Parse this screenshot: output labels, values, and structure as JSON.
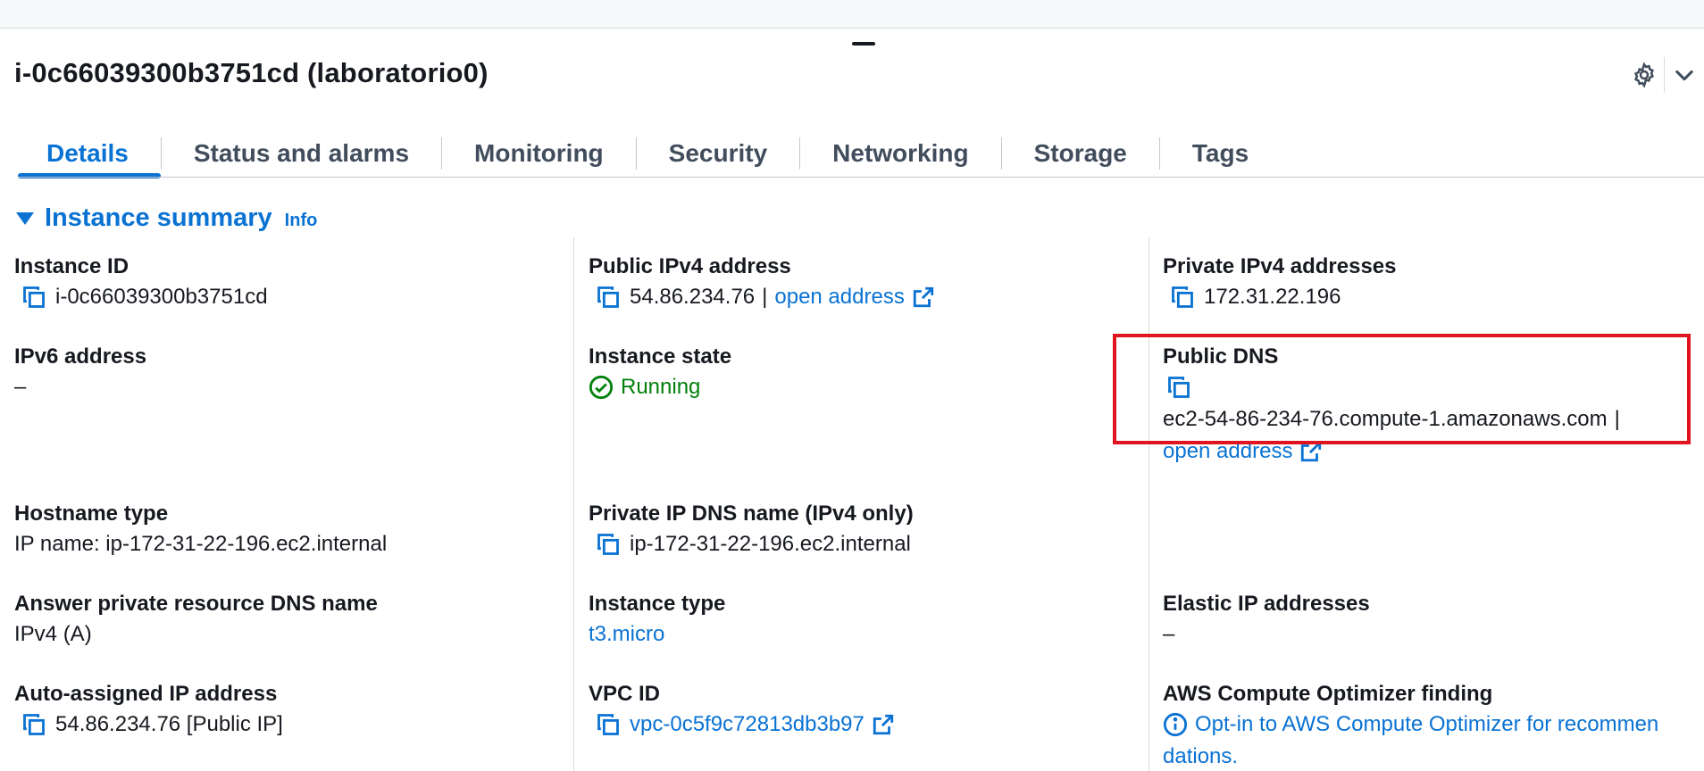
{
  "instance": {
    "title": "i-0c66039300b3751cd (laboratorio0)"
  },
  "icons": {
    "settings": "gear-icon",
    "collapse": "chevron-down-icon",
    "copy": "copy-icon",
    "external": "external-link-icon",
    "running": "check-circle-icon",
    "info": "info-circle-icon"
  },
  "colors": {
    "link": "#0972d3",
    "success": "#037f0c",
    "highlight": "#e0141e"
  },
  "tabs": [
    {
      "label": "Details",
      "active": true
    },
    {
      "label": "Status and alarms"
    },
    {
      "label": "Monitoring"
    },
    {
      "label": "Security"
    },
    {
      "label": "Networking"
    },
    {
      "label": "Storage"
    },
    {
      "label": "Tags"
    }
  ],
  "summary": {
    "title": "Instance summary",
    "info": "Info",
    "instance_id": {
      "label": "Instance ID",
      "value": "i-0c66039300b3751cd"
    },
    "public_ipv4": {
      "label": "Public IPv4 address",
      "value": "54.86.234.76",
      "separator": "|",
      "link": "open address"
    },
    "private_ipv4": {
      "label": "Private IPv4 addresses",
      "value": "172.31.22.196"
    },
    "ipv6": {
      "label": "IPv6 address",
      "value": "–"
    },
    "instance_state": {
      "label": "Instance state",
      "value": "Running"
    },
    "public_dns": {
      "label": "Public DNS",
      "value": "ec2-54-86-234-76.compute-1.amazonaws.com",
      "separator": "|",
      "link": "open address"
    },
    "hostname_type": {
      "label": "Hostname type",
      "value": "IP name: ip-172-31-22-196.ec2.internal"
    },
    "private_dns": {
      "label": "Private IP DNS name (IPv4 only)",
      "value": "ip-172-31-22-196.ec2.internal"
    },
    "answer_dns": {
      "label": "Answer private resource DNS name",
      "value": "IPv4 (A)"
    },
    "instance_type": {
      "label": "Instance type",
      "value": "t3.micro"
    },
    "elastic_ip": {
      "label": "Elastic IP addresses",
      "value": "–"
    },
    "auto_ip": {
      "label": "Auto-assigned IP address",
      "value": "54.86.234.76 [Public IP]"
    },
    "vpc_id": {
      "label": "VPC ID",
      "value": "vpc-0c5f9c72813db3b97"
    },
    "optimizer": {
      "label": "AWS Compute Optimizer finding",
      "line1": "Opt-in to AWS Compute Optimizer for recommen",
      "line2": "dations."
    }
  }
}
